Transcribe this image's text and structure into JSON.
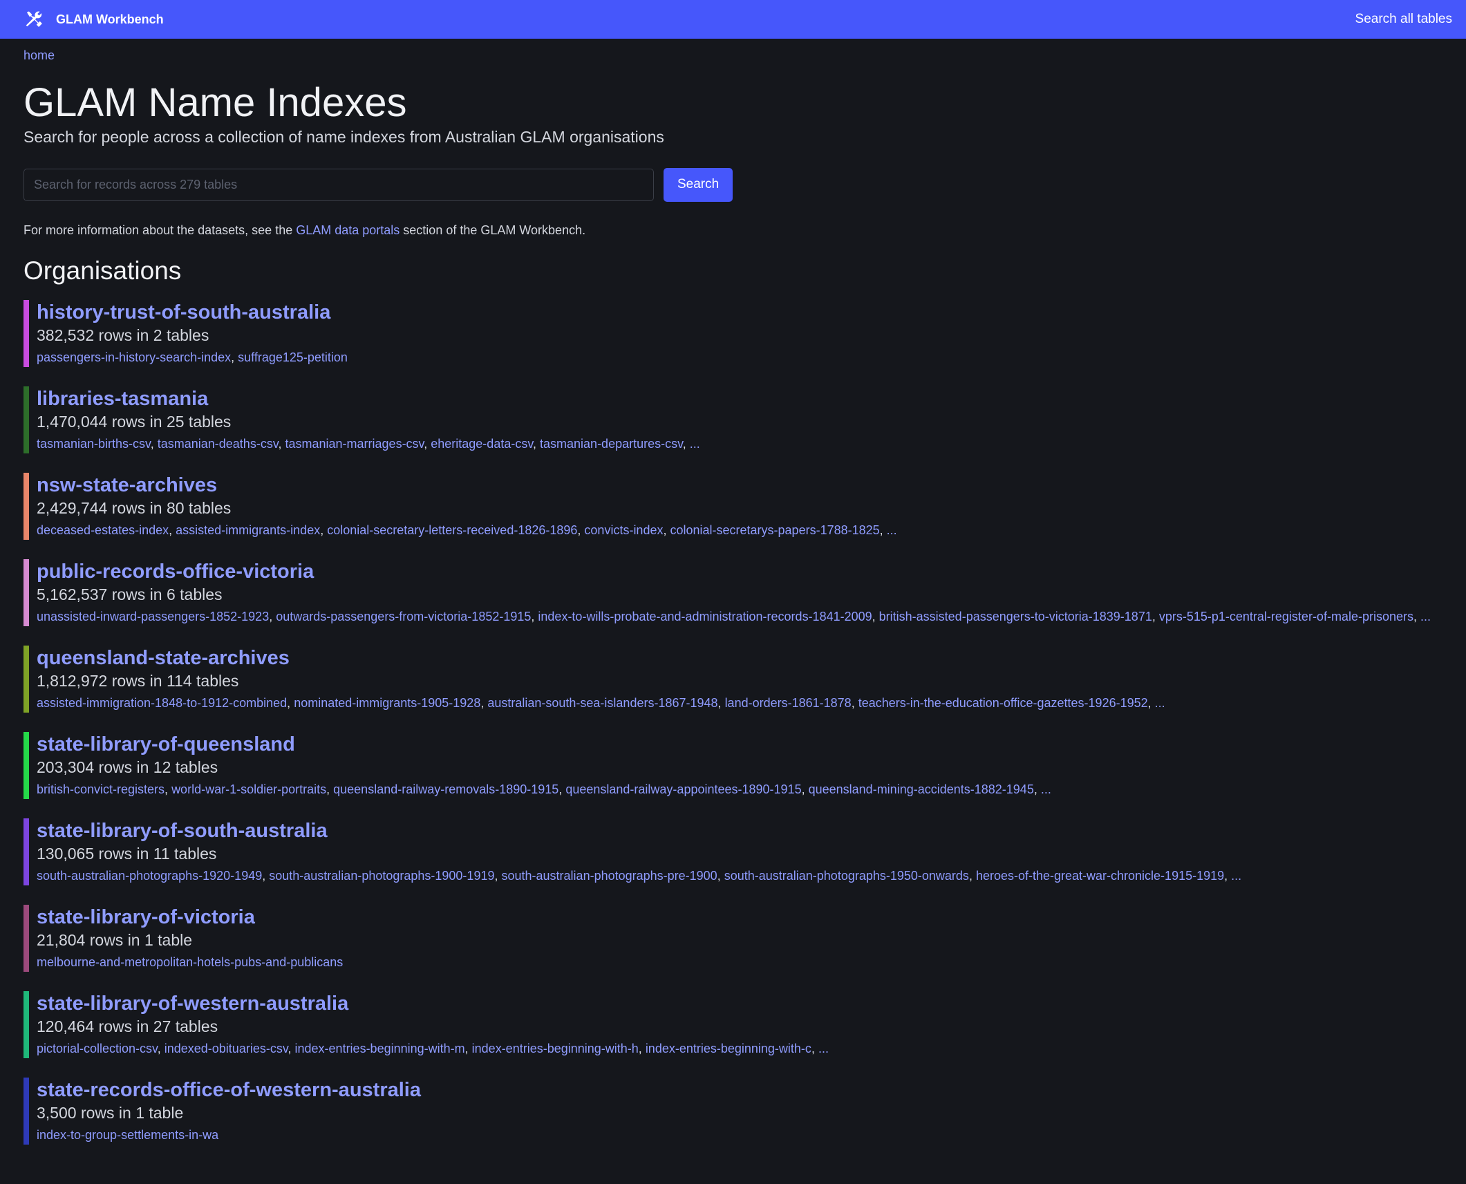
{
  "topbar": {
    "brand_label": "GLAM Workbench",
    "brand_icon": "tools-icon",
    "nav_link": "Search all tables",
    "accent_color": "#4657fb"
  },
  "breadcrumb": {
    "home": "home"
  },
  "header": {
    "title": "GLAM Name Indexes",
    "subtitle": "Search for people across a collection of name indexes from Australian GLAM organisations"
  },
  "search": {
    "placeholder": "Search for records across 279 tables",
    "value": "",
    "button_label": "Search"
  },
  "info": {
    "before": "For more information about the datasets, see the ",
    "link": "GLAM data portals",
    "after": " section of the GLAM Workbench."
  },
  "organisations_heading": "Organisations",
  "organisations": [
    {
      "name": "history-trust-of-south-australia",
      "color": "#c94ce0",
      "rows": "382,532 rows in 2 tables",
      "tables": [
        "passengers-in-history-search-index",
        "suffrage125-petition"
      ],
      "more": ""
    },
    {
      "name": "libraries-tasmania",
      "color": "#2d6e2a",
      "rows": "1,470,044 rows in 25 tables",
      "tables": [
        "tasmanian-births-csv",
        "tasmanian-deaths-csv",
        "tasmanian-marriages-csv",
        "eheritage-data-csv",
        "tasmanian-departures-csv"
      ],
      "more": "..."
    },
    {
      "name": "nsw-state-archives",
      "color": "#e9866a",
      "rows": "2,429,744 rows in 80 tables",
      "tables": [
        "deceased-estates-index",
        "assisted-immigrants-index",
        "colonial-secretary-letters-received-1826-1896",
        "convicts-index",
        "colonial-secretarys-papers-1788-1825"
      ],
      "more": "..."
    },
    {
      "name": "public-records-office-victoria",
      "color": "#d68ad1",
      "rows": "5,162,537 rows in 6 tables",
      "tables": [
        "unassisted-inward-passengers-1852-1923",
        "outwards-passengers-from-victoria-1852-1915",
        "index-to-wills-probate-and-administration-records-1841-2009",
        "british-assisted-passengers-to-victoria-1839-1871",
        "vprs-515-p1-central-register-of-male-prisoners"
      ],
      "more": "..."
    },
    {
      "name": "queensland-state-archives",
      "color": "#7fa326",
      "rows": "1,812,972 rows in 114 tables",
      "tables": [
        "assisted-immigration-1848-to-1912-combined",
        "nominated-immigrants-1905-1928",
        "australian-south-sea-islanders-1867-1948",
        "land-orders-1861-1878",
        "teachers-in-the-education-office-gazettes-1926-1952"
      ],
      "more": "..."
    },
    {
      "name": "state-library-of-queensland",
      "color": "#25d949",
      "rows": "203,304 rows in 12 tables",
      "tables": [
        "british-convict-registers",
        "world-war-1-soldier-portraits",
        "queensland-railway-removals-1890-1915",
        "queensland-railway-appointees-1890-1915",
        "queensland-mining-accidents-1882-1945"
      ],
      "more": "..."
    },
    {
      "name": "state-library-of-south-australia",
      "color": "#7d45e0",
      "rows": "130,065 rows in 11 tables",
      "tables": [
        "south-australian-photographs-1920-1949",
        "south-australian-photographs-1900-1919",
        "south-australian-photographs-pre-1900",
        "south-australian-photographs-1950-onwards",
        "heroes-of-the-great-war-chronicle-1915-1919"
      ],
      "more": "..."
    },
    {
      "name": "state-library-of-victoria",
      "color": "#9c4a7c",
      "rows": "21,804 rows in 1 table",
      "tables": [
        "melbourne-and-metropolitan-hotels-pubs-and-publicans"
      ],
      "more": ""
    },
    {
      "name": "state-library-of-western-australia",
      "color": "#1fb87a",
      "rows": "120,464 rows in 27 tables",
      "tables": [
        "pictorial-collection-csv",
        "indexed-obituaries-csv",
        "index-entries-beginning-with-m",
        "index-entries-beginning-with-h",
        "index-entries-beginning-with-c"
      ],
      "more": "..."
    },
    {
      "name": "state-records-office-of-western-australia",
      "color": "#2e3ab8",
      "rows": "3,500 rows in 1 table",
      "tables": [
        "index-to-group-settlements-in-wa"
      ],
      "more": ""
    }
  ]
}
